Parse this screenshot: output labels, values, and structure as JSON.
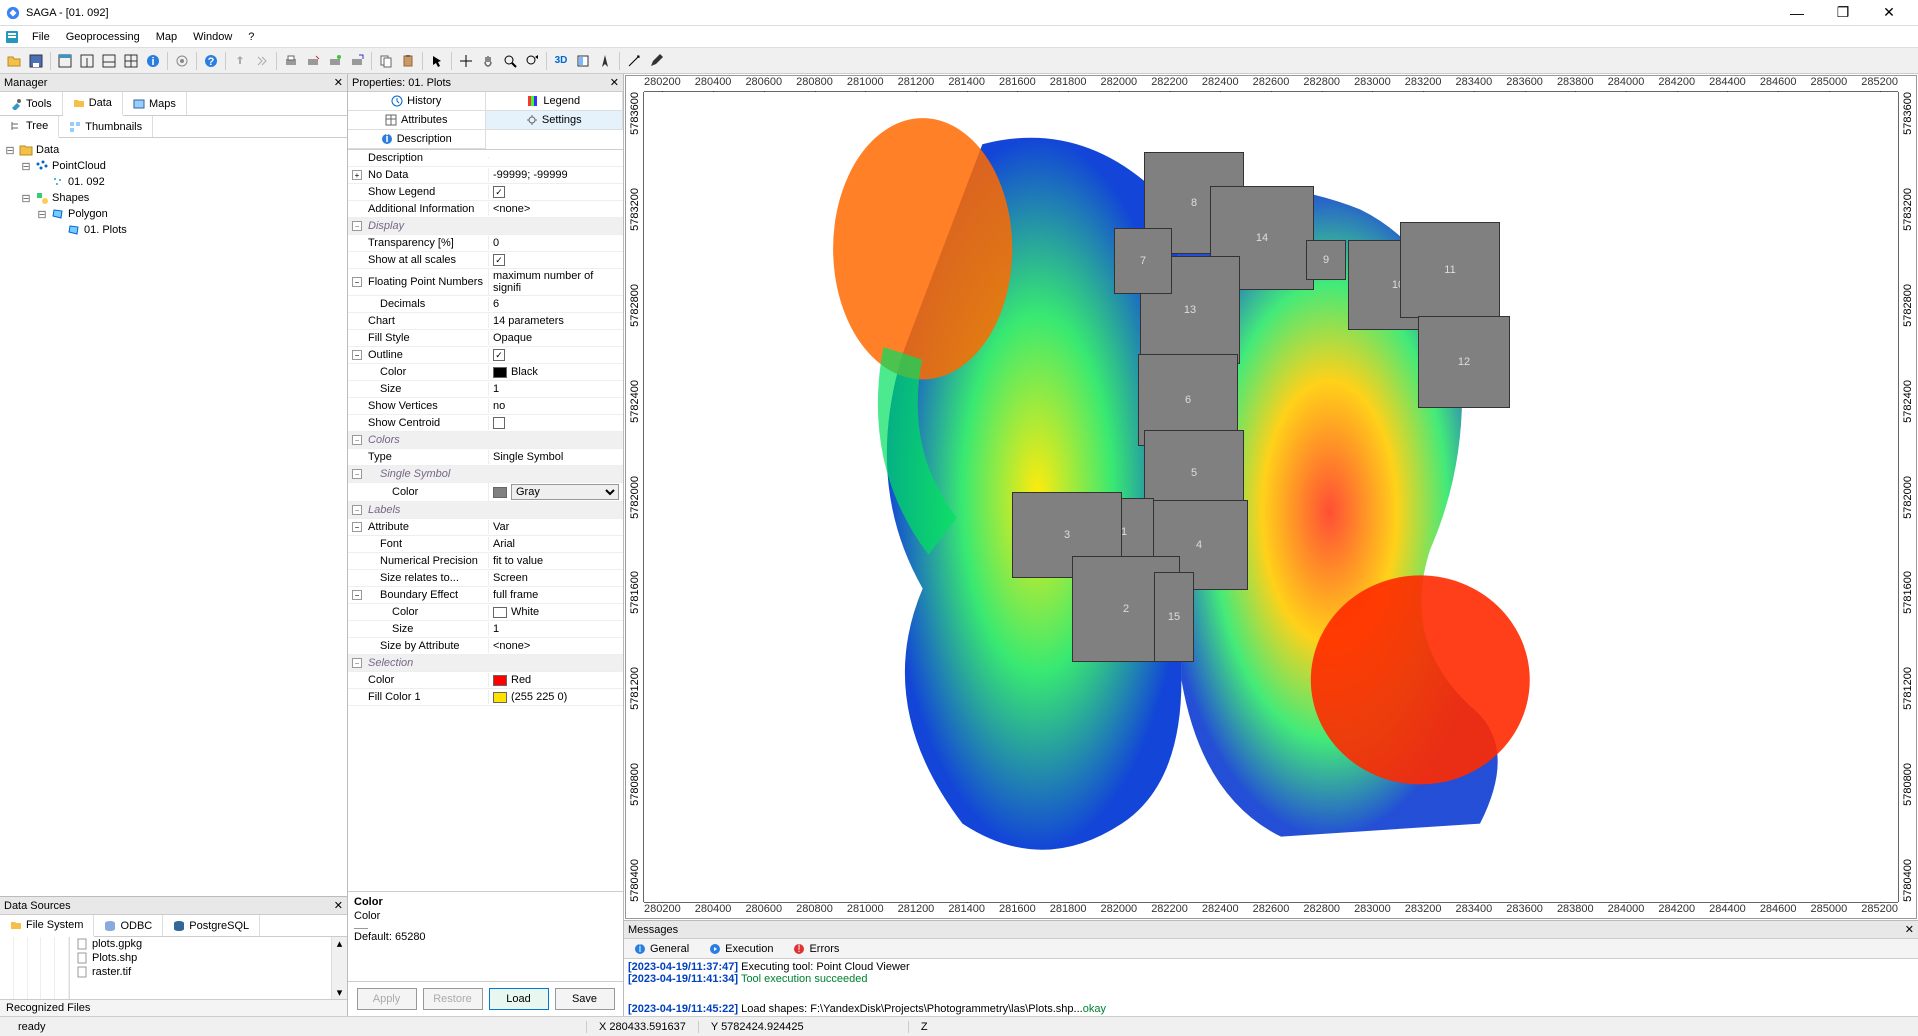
{
  "window": {
    "title": "SAGA - [01. 092]"
  },
  "menu": {
    "file": "File",
    "geoproc": "Geoprocessing",
    "map": "Map",
    "window": "Window",
    "help": "?"
  },
  "manager": {
    "header": "Manager",
    "tabs": {
      "tools": "Tools",
      "data": "Data",
      "maps": "Maps"
    },
    "subtabs": {
      "tree": "Tree",
      "thumbs": "Thumbnails"
    },
    "tree": {
      "root": "Data",
      "pointcloud": "PointCloud",
      "pc1": "01. 092",
      "shapes": "Shapes",
      "polygon": "Polygon",
      "plots": "01. Plots"
    }
  },
  "datasources": {
    "header": "Data Sources",
    "tabs": {
      "fs": "File System",
      "odbc": "ODBC",
      "pg": "PostgreSQL"
    },
    "files": {
      "f1": "plots.gpkg",
      "f2": "Plots.shp",
      "f3": "raster.tif"
    },
    "footer": "Recognized Files"
  },
  "properties": {
    "header": "Properties: 01. Plots",
    "tabs": {
      "history": "History",
      "legend": "Legend",
      "attributes": "Attributes",
      "settings": "Settings",
      "description": "Description"
    },
    "rows": {
      "description_lbl": "Description",
      "nodata_lbl": "No Data",
      "nodata_val": "-99999; -99999",
      "showlegend_lbl": "Show Legend",
      "addinfo_lbl": "Additional Information",
      "addinfo_val": "<none>",
      "display_grp": "Display",
      "transp_lbl": "Transparency [%]",
      "transp_val": "0",
      "showall_lbl": "Show at all scales",
      "float_lbl": "Floating Point Numbers",
      "float_val": "maximum number of signifi",
      "decimals_lbl": "Decimals",
      "decimals_val": "6",
      "chart_lbl": "Chart",
      "chart_val": "14 parameters",
      "fillstyle_lbl": "Fill Style",
      "fillstyle_val": "Opaque",
      "outline_lbl": "Outline",
      "outline_color_lbl": "Color",
      "outline_color_val": "Black",
      "outline_size_lbl": "Size",
      "outline_size_val": "1",
      "showvert_lbl": "Show Vertices",
      "showvert_val": "no",
      "showcent_lbl": "Show Centroid",
      "colors_grp": "Colors",
      "type_lbl": "Type",
      "type_val": "Single Symbol",
      "singlesym_grp": "Single Symbol",
      "sym_color_lbl": "Color",
      "sym_color_val": "Gray",
      "labels_grp": "Labels",
      "attr_lbl": "Attribute",
      "attr_val": "Var",
      "font_lbl": "Font",
      "font_val": "Arial",
      "numprec_lbl": "Numerical Precision",
      "numprec_val": "fit to value",
      "sizerel_lbl": "Size relates to...",
      "sizerel_val": "Screen",
      "boundeff_lbl": "Boundary Effect",
      "boundeff_val": "full frame",
      "be_color_lbl": "Color",
      "be_color_val": "White",
      "be_size_lbl": "Size",
      "be_size_val": "1",
      "sizebyattr_lbl": "Size by Attribute",
      "sizebyattr_val": "<none>",
      "selection_grp": "Selection",
      "sel_color_lbl": "Color",
      "sel_color_val": "Red",
      "sel_fill_lbl": "Fill Color 1",
      "sel_fill_val": "(255 225 0)"
    },
    "desc": {
      "title": "Color",
      "body": "Color",
      "def": "Default: 65280"
    },
    "buttons": {
      "apply": "Apply",
      "restore": "Restore",
      "load": "Load",
      "save": "Save"
    }
  },
  "map": {
    "x_ticks": [
      "280200",
      "280400",
      "280600",
      "280800",
      "281000",
      "281200",
      "281400",
      "281600",
      "281800",
      "282000",
      "282200",
      "282400",
      "282600",
      "282800",
      "283000",
      "283200",
      "283400",
      "283600",
      "283800",
      "284000",
      "284200",
      "284400",
      "284600",
      "285000",
      "285200"
    ],
    "y_ticks": [
      "5783600",
      "5783200",
      "5782800",
      "5782400",
      "5782000",
      "5781600",
      "5781200",
      "5780800",
      "5780400"
    ],
    "plots": {
      "p1": "1",
      "p2": "2",
      "p3": "3",
      "p4": "4",
      "p5": "5",
      "p6": "6",
      "p7": "7",
      "p8": "8",
      "p9": "9",
      "p10": "10",
      "p11": "11",
      "p12": "12",
      "p13": "13",
      "p14": "14",
      "p15": "15"
    }
  },
  "messages": {
    "header": "Messages",
    "tabs": {
      "general": "General",
      "execution": "Execution",
      "errors": "Errors"
    },
    "rows": {
      "r1ts": "[2023-04-19/11:37:47]",
      "r1": "Executing tool: Point Cloud Viewer",
      "r2ts": "[2023-04-19/11:41:34]",
      "r2": "Tool execution succeeded",
      "r3ts": "[2023-04-19/11:45:22]",
      "r3a": "Load shapes: F:\\YandexDisk\\Projects\\Photogrammetry\\las\\Plots.shp...",
      "r3b": "okay"
    }
  },
  "status": {
    "ready": "ready",
    "x": "X 280433.591637",
    "y": "Y 5782424.924425",
    "z": "Z"
  }
}
